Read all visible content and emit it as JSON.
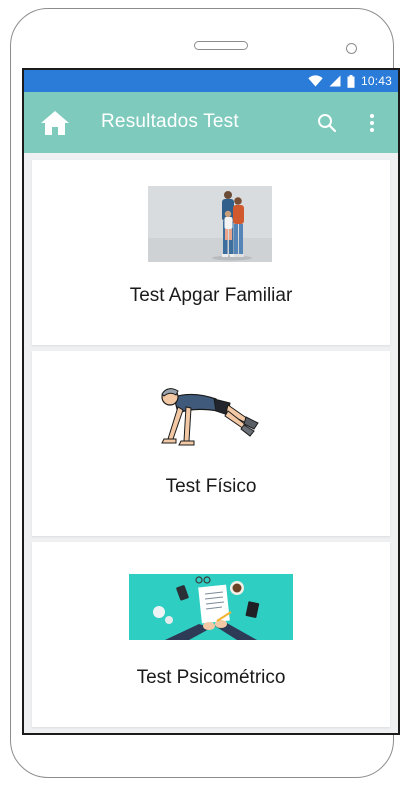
{
  "status_bar": {
    "time": "10:43",
    "icons": [
      "wifi-icon",
      "signal-icon",
      "battery-icon"
    ]
  },
  "app_bar": {
    "title": "Resultados Test",
    "home_icon": "home-icon",
    "search_icon": "search-icon",
    "menu_icon": "more-vert-icon"
  },
  "cards": [
    {
      "label": "Test Apgar Familiar",
      "image": "family-photo"
    },
    {
      "label": "Test Físico",
      "image": "pushup-illustration"
    },
    {
      "label": "Test Psicométrico",
      "image": "desk-writing-illustration"
    }
  ],
  "colors": {
    "status_bar": "#2b7bd8",
    "app_bar": "#7ecbbd",
    "background": "#eef0f1",
    "card": "#ffffff"
  }
}
